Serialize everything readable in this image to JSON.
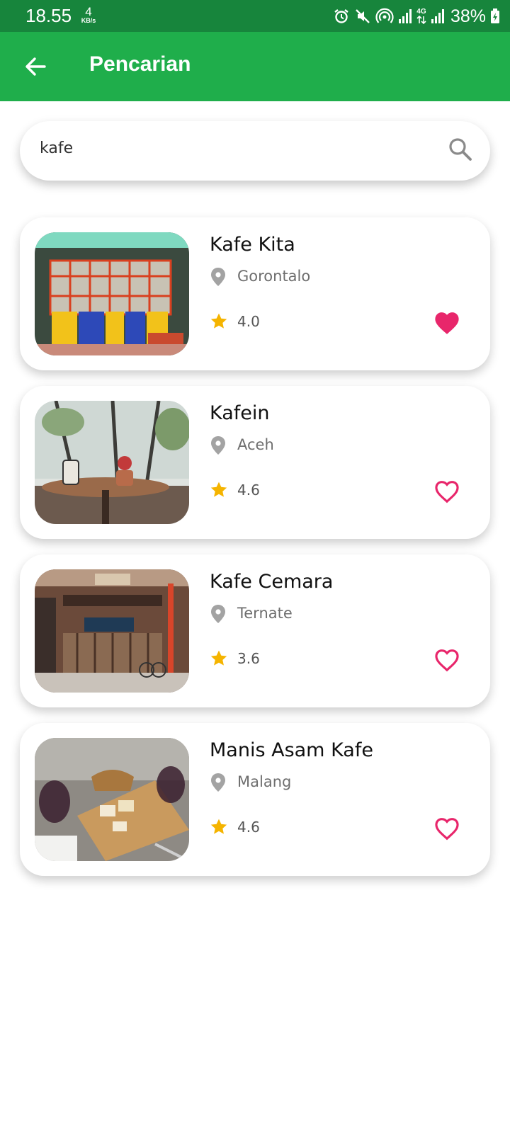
{
  "status_bar": {
    "time": "18.55",
    "speed_value": "4",
    "speed_unit": "KB/s",
    "network_type": "4G",
    "battery_percent": "38%"
  },
  "app_bar": {
    "title": "Pencarian"
  },
  "search": {
    "value": "kafe"
  },
  "colors": {
    "status_bar": "#17853c",
    "app_bar": "#1fae4b",
    "favorite": "#e8266b",
    "star": "#f5b400",
    "pin": "#9e9e9e"
  },
  "results": [
    {
      "name": "Kafe Kita",
      "location": "Gorontalo",
      "rating": "4.0",
      "favorite": true,
      "thumbnail": "storefront-photo"
    },
    {
      "name": "Kafein",
      "location": "Aceh",
      "rating": "4.6",
      "favorite": false,
      "thumbnail": "cafe-table-photo"
    },
    {
      "name": "Kafe Cemara",
      "location": "Ternate",
      "rating": "3.6",
      "favorite": false,
      "thumbnail": "japanese-shop-photo"
    },
    {
      "name": "Manis Asam Kafe",
      "location": "Malang",
      "rating": "4.6",
      "favorite": false,
      "thumbnail": "cheese-wine-photo"
    }
  ]
}
